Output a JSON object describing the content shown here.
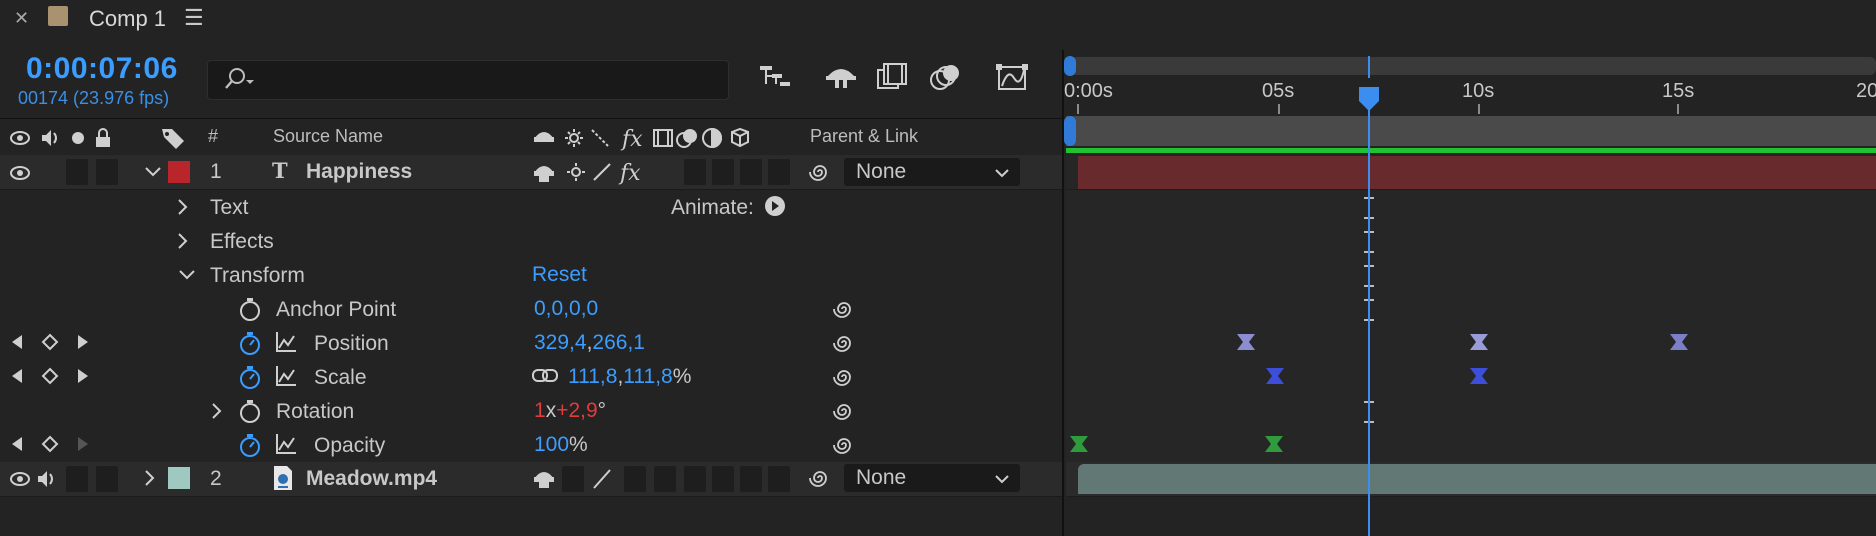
{
  "tab": {
    "title": "Comp 1",
    "swatch_color": "#a89270"
  },
  "header": {
    "timecode": "0:00:07:06",
    "frame_info": "00174 (23.976 fps)",
    "search_placeholder": ""
  },
  "columns": {
    "hash": "#",
    "source_name": "Source Name",
    "parent_link": "Parent & Link"
  },
  "ruler": {
    "labels": [
      "0:00s",
      "05s",
      "10s",
      "15s",
      "20"
    ]
  },
  "layers": [
    {
      "number": "1",
      "name": "Happiness",
      "type_glyph": "T",
      "label_color": "#b8262c",
      "parent": "None",
      "bar_color": "#682a2c"
    },
    {
      "number": "2",
      "name": "Meadow.mp4",
      "label_color": "#9fc8c0",
      "parent": "None",
      "bar_color": "#627874"
    }
  ],
  "props": {
    "text": "Text",
    "animate": "Animate:",
    "effects": "Effects",
    "transform": "Transform",
    "reset": "Reset",
    "anchor_point": {
      "label": "Anchor Point",
      "value": "0,0,0,0"
    },
    "position": {
      "label": "Position",
      "x": "329,4",
      "sep": ",",
      "y": "266,1"
    },
    "scale": {
      "label": "Scale",
      "x": "111,8",
      "sep": ",",
      "y": "111,8",
      "unit": "%"
    },
    "rotation": {
      "label": "Rotation",
      "turns": "1",
      "x": "x",
      "deg": "+2,9",
      "unit": "°"
    },
    "opacity": {
      "label": "Opacity",
      "value": "100",
      "unit": "%"
    }
  },
  "colors": {
    "accent": "#3b9dff",
    "work_area_green": "#22c12f",
    "playhead": "#3b8ef0"
  }
}
